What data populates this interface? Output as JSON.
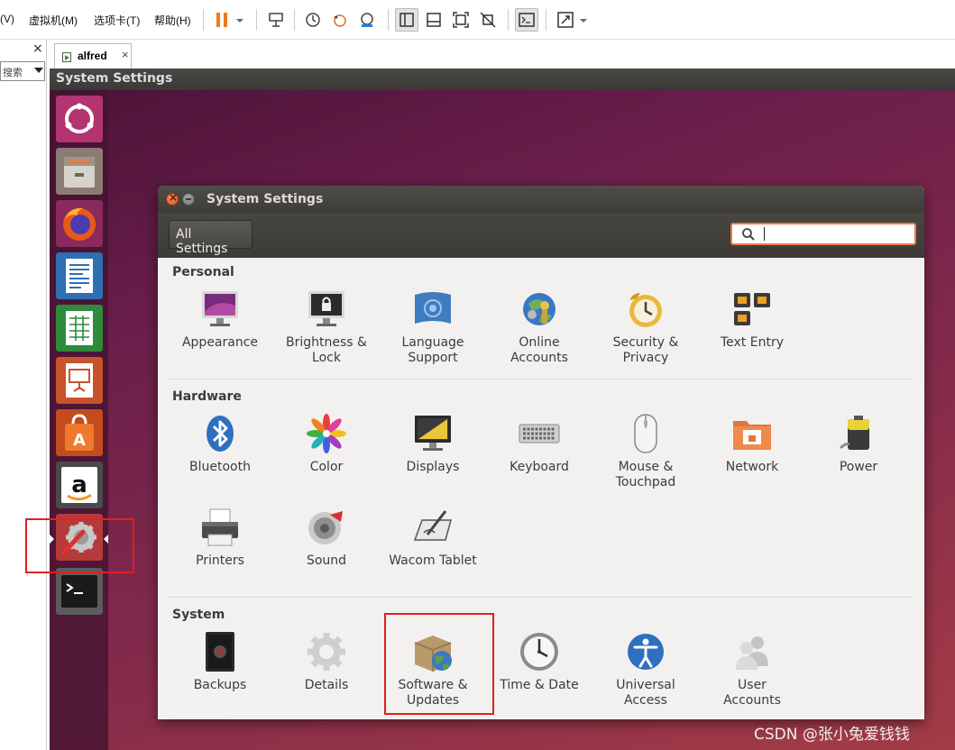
{
  "host": {
    "menus": [
      "(V)",
      "虚拟机(M)",
      "选项卡(T)",
      "帮助(H)"
    ],
    "library_search_placeholder": "搜索",
    "library_close": "×",
    "vm_tab": {
      "label": "alfred",
      "close": "×"
    }
  },
  "guest": {
    "topbar_title": "System Settings",
    "launcher": [
      "dash-home",
      "files",
      "firefox",
      "libreoffice-writer",
      "libreoffice-calc",
      "libreoffice-impress",
      "ubuntu-software",
      "amazon",
      "system-settings",
      "terminal"
    ]
  },
  "settings": {
    "title": "System Settings",
    "all_settings_label": "All Settings",
    "search_value": "",
    "sections": [
      {
        "title": "Personal",
        "items": [
          {
            "label": "Appearance",
            "icon": "appearance-icon"
          },
          {
            "label": "Brightness &\nLock",
            "icon": "brightness-lock-icon"
          },
          {
            "label": "Language\nSupport",
            "icon": "language-support-icon"
          },
          {
            "label": "Online\nAccounts",
            "icon": "online-accounts-icon"
          },
          {
            "label": "Security &\nPrivacy",
            "icon": "security-privacy-icon"
          },
          {
            "label": "Text Entry",
            "icon": "text-entry-icon"
          }
        ]
      },
      {
        "title": "Hardware",
        "items": [
          {
            "label": "Bluetooth",
            "icon": "bluetooth-icon"
          },
          {
            "label": "Color",
            "icon": "color-icon"
          },
          {
            "label": "Displays",
            "icon": "displays-icon"
          },
          {
            "label": "Keyboard",
            "icon": "keyboard-icon"
          },
          {
            "label": "Mouse &\nTouchpad",
            "icon": "mouse-touchpad-icon"
          },
          {
            "label": "Network",
            "icon": "network-icon"
          },
          {
            "label": "Power",
            "icon": "power-icon"
          },
          {
            "label": "Printers",
            "icon": "printers-icon"
          },
          {
            "label": "Sound",
            "icon": "sound-icon"
          },
          {
            "label": "Wacom Tablet",
            "icon": "wacom-tablet-icon"
          }
        ]
      },
      {
        "title": "System",
        "items": [
          {
            "label": "Backups",
            "icon": "backups-icon"
          },
          {
            "label": "Details",
            "icon": "details-icon"
          },
          {
            "label": "Software &\nUpdates",
            "icon": "software-updates-icon"
          },
          {
            "label": "Time & Date",
            "icon": "time-date-icon"
          },
          {
            "label": "Universal\nAccess",
            "icon": "universal-access-icon"
          },
          {
            "label": "User\nAccounts",
            "icon": "user-accounts-icon"
          }
        ]
      }
    ]
  },
  "watermark": "CSDN @张小兔爱钱钱",
  "colors": {
    "accent_orange": "#f07746",
    "annotation_red": "#e02020",
    "launcher_bg": "#46142f"
  }
}
